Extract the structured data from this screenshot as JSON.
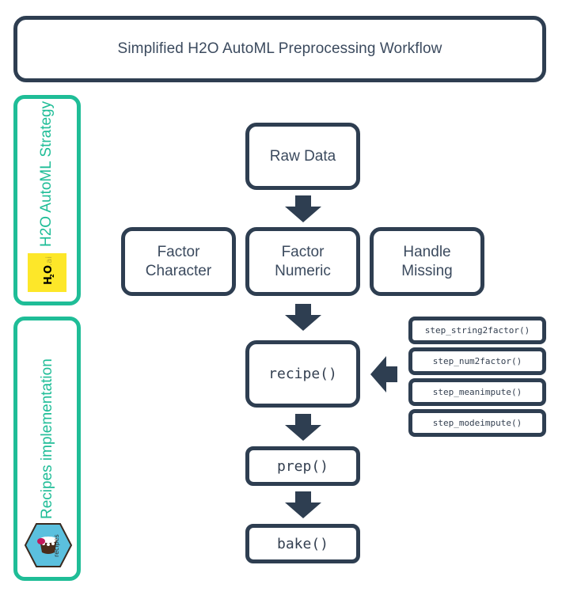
{
  "title": "Simplified H2O AutoML Preprocessing Workflow",
  "colors": {
    "dark": "#2e3e51",
    "accent": "#1fbd97",
    "h2o_yellow": "#fde729",
    "recipes_blue": "#5bc0de"
  },
  "sidebar": {
    "h2o": {
      "label": "H2O AutoML Strategy",
      "logo_text": "H2O",
      "logo_suffix": "ai",
      "logo_icon": "h2o-ai-logo"
    },
    "recipes": {
      "label": "Recipes implementation",
      "logo_text": "recipes",
      "logo_icon": "recipes-hex-logo"
    }
  },
  "flow": {
    "raw": "Raw Data",
    "strategies": [
      {
        "line1": "Factor",
        "line2": "Character"
      },
      {
        "line1": "Factor",
        "line2": "Numeric"
      },
      {
        "line1": "Handle",
        "line2": "Missing"
      }
    ],
    "recipe": "recipe()",
    "prep": "prep()",
    "bake": "bake()",
    "steps": [
      "step_string2factor()",
      "step_num2factor()",
      "step_meanimpute()",
      "step_modeimpute()"
    ]
  }
}
